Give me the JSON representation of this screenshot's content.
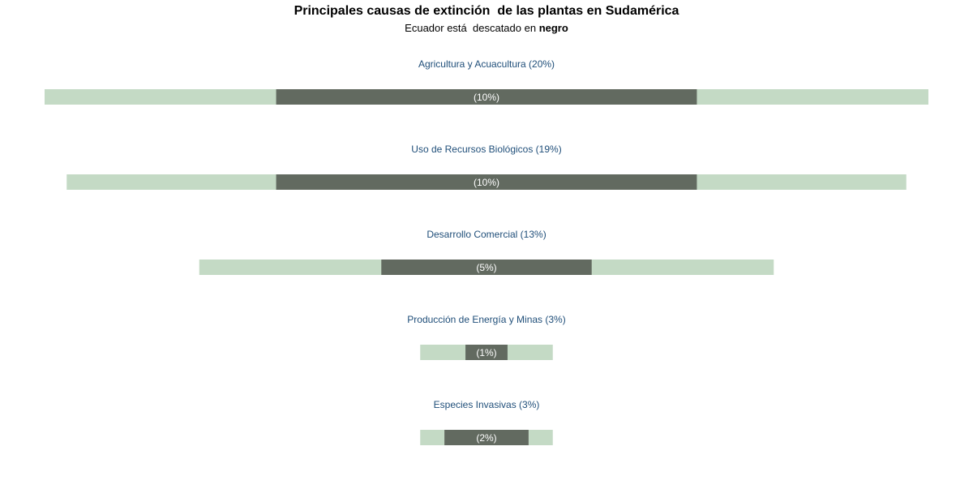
{
  "chart_data": {
    "type": "bar",
    "title": "Principales causas de extinción  de las plantas en Sudamérica",
    "subtitle_prefix": "Ecuador está  descatado en ",
    "subtitle_bold": "negro",
    "series": [
      {
        "name": "Sudamérica"
      },
      {
        "name": "Ecuador"
      }
    ],
    "colors": {
      "sudamerica": "#c4dac5",
      "ecuador": "#626a60",
      "category_label": "#1f4e79",
      "value_label": "#ffffff"
    },
    "categories": [
      {
        "label": "Agricultura y Acuacultura (20%)",
        "sudamerica": 20,
        "ecuador": 10,
        "ecuador_label": "(10%)"
      },
      {
        "label": "Uso de Recursos Biológicos (19%)",
        "sudamerica": 19,
        "ecuador": 10,
        "ecuador_label": "(10%)"
      },
      {
        "label": "Desarrollo Comercial (13%)",
        "sudamerica": 13,
        "ecuador": 5,
        "ecuador_label": "(5%)"
      },
      {
        "label": "Producción de Energía y Minas (3%)",
        "sudamerica": 3,
        "ecuador": 1,
        "ecuador_label": "(1%)"
      },
      {
        "label": "Especies Invasivas (3%)",
        "sudamerica": 3,
        "ecuador": 2,
        "ecuador_label": "(2%)"
      }
    ]
  }
}
